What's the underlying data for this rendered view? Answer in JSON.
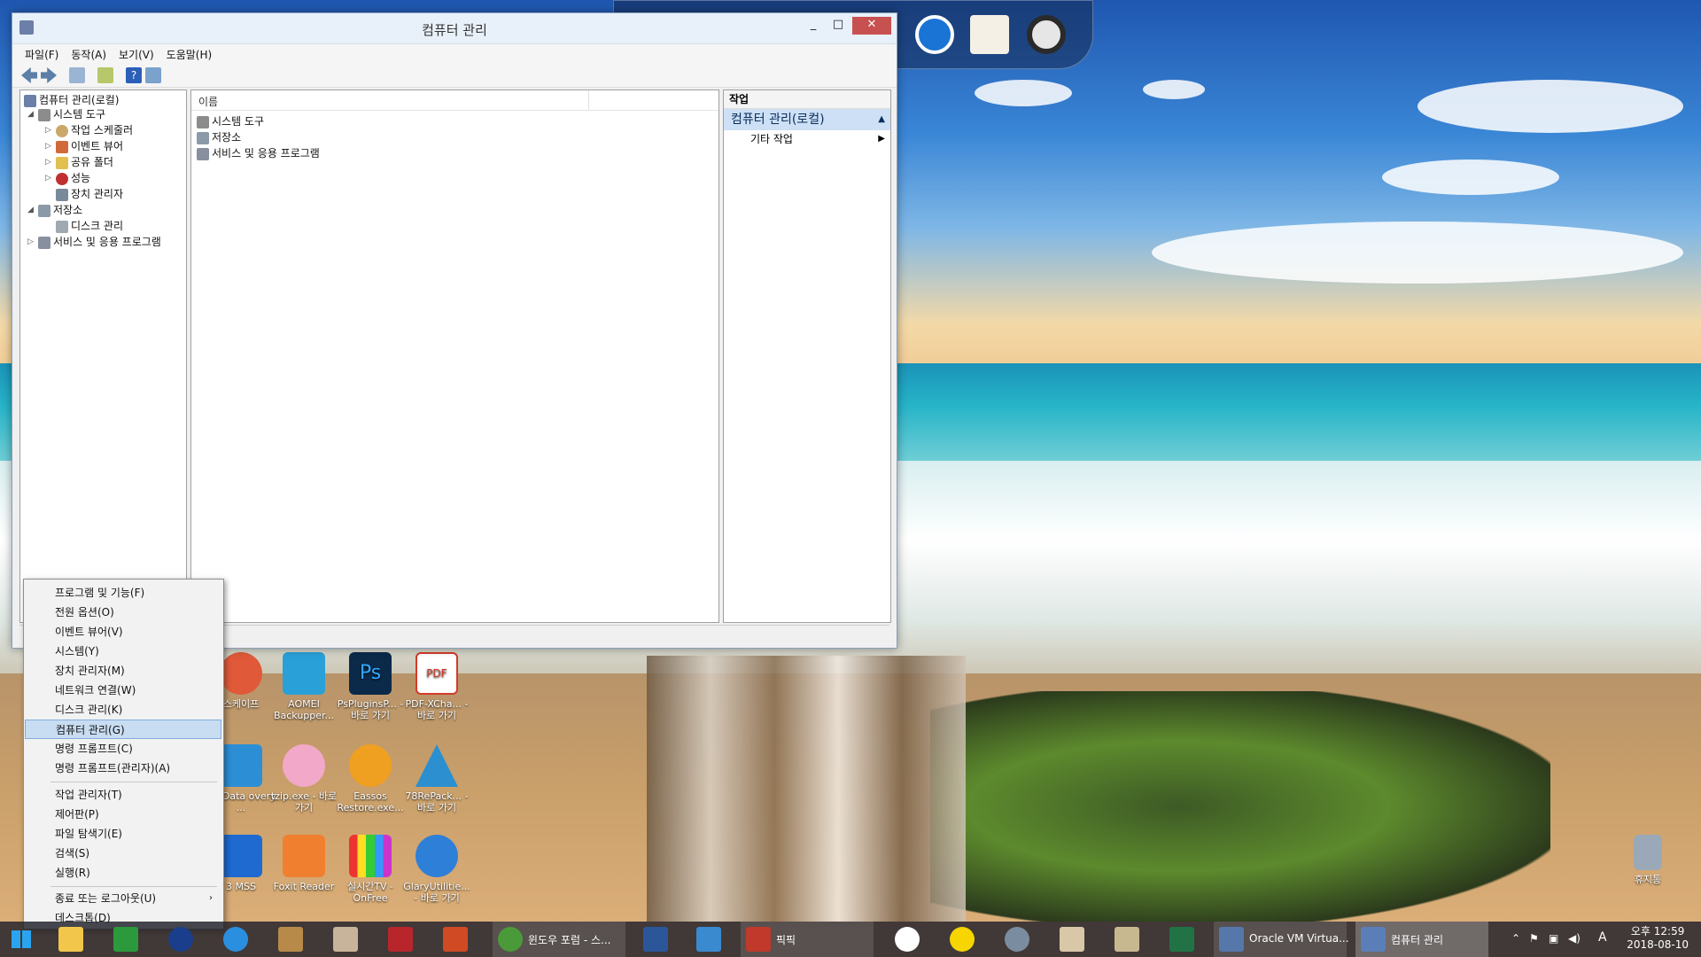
{
  "window": {
    "title": "컴퓨터 관리",
    "menu": [
      "파일(F)",
      "동작(A)",
      "보기(V)",
      "도움말(H)"
    ],
    "controls": {
      "minimize": "_",
      "maximize": "□",
      "close": "✕"
    }
  },
  "tree": {
    "root": "컴퓨터 관리(로컬)",
    "items": [
      {
        "label": "시스템 도구"
      },
      {
        "label": "작업 스케줄러"
      },
      {
        "label": "이벤트 뷰어"
      },
      {
        "label": "공유 폴더"
      },
      {
        "label": "성능"
      },
      {
        "label": "장치 관리자"
      },
      {
        "label": "저장소"
      },
      {
        "label": "디스크 관리"
      },
      {
        "label": "서비스 및 응용 프로그램"
      }
    ]
  },
  "list": {
    "column": "이름",
    "items": [
      "시스템 도구",
      "저장소",
      "서비스 및 응용 프로그램"
    ]
  },
  "actions": {
    "title": "작업",
    "section": "컴퓨터 관리(로컬)",
    "more": "기타 작업"
  },
  "winx_menu": {
    "items": [
      "프로그램 및 기능(F)",
      "전원 옵션(O)",
      "이벤트 뷰어(V)",
      "시스템(Y)",
      "장치 관리자(M)",
      "네트워크 연결(W)",
      "디스크 관리(K)",
      "컴퓨터 관리(G)",
      "명령 프롬프트(C)",
      "명령 프롬프트(관리자)(A)",
      "작업 관리자(T)",
      "제어판(P)",
      "파일 탐색기(E)",
      "검색(S)",
      "실행(R)",
      "종료 또는 로그아웃(U)",
      "데스크톱(D)"
    ],
    "selected": "컴퓨터 관리(G)"
  },
  "desktop_icons": [
    {
      "label": "스케이프",
      "color": "#e05a3a"
    },
    {
      "label": "AOMEI Backupper...",
      "color": "#2aa0d8"
    },
    {
      "label": "PsPluginsP... - 바로 가기",
      "color": "#0b2a4a"
    },
    {
      "label": "PDF-XCha... - 바로 가기",
      "color": "#d23b2b"
    },
    {
      "label": "US Data overy ...",
      "color": "#2c8fd6"
    },
    {
      "label": "tzip.exe - 바로 가기",
      "color": "#f2a8c8"
    },
    {
      "label": "Eassos Restore.exe...",
      "color": "#f0a020"
    },
    {
      "label": "78RePack... - 바로 가기",
      "color": "#2b8fd0"
    },
    {
      "label": "3 MSS",
      "color": "#1e6ad0"
    },
    {
      "label": "Foxit Reader",
      "color": "#f08030"
    },
    {
      "label": "실시간TV - OnFree",
      "color": "#222222"
    },
    {
      "label": "GlaryUtilitie... - 바로 가기",
      "color": "#2e7fd8"
    },
    {
      "label": "휴지통",
      "color": "#9aa8b8"
    }
  ],
  "taskbar": {
    "buttons": [
      {
        "label": "윈도우 포럼 - 스...",
        "color": "#4a9a3a"
      },
      {
        "label": "픽픽",
        "color": "#c0392b"
      },
      {
        "label": "Oracle VM Virtua...",
        "color": "#5577aa"
      },
      {
        "label": "컴퓨터 관리",
        "color": "#5a7fb8"
      }
    ],
    "clock_time": "오후 12:59",
    "clock_date": "2018-08-10",
    "ime": "A"
  }
}
